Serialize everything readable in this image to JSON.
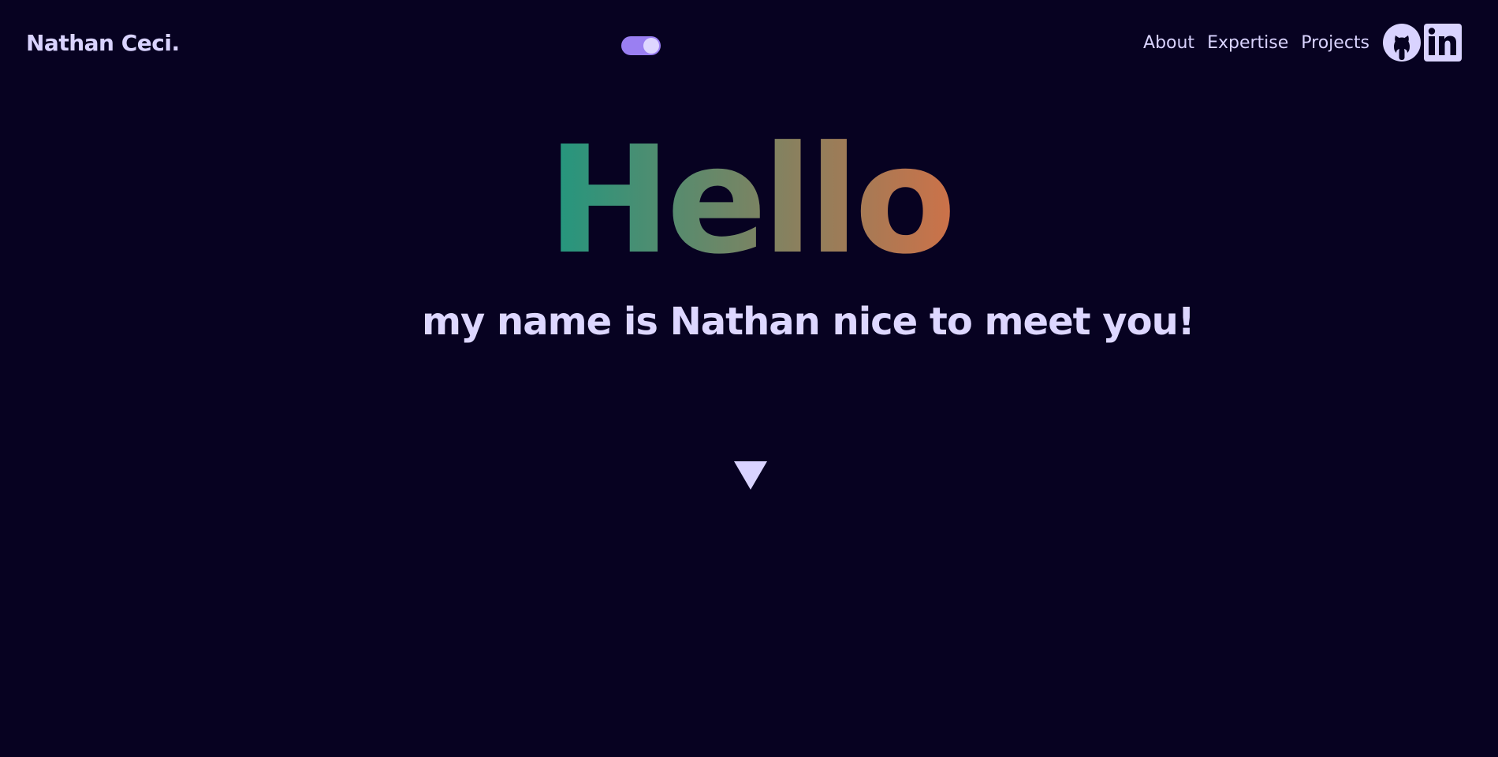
{
  "brand": {
    "name": "Nathan Ceci."
  },
  "theme_toggle": {
    "state": "on",
    "icon": "toggle-icon",
    "color": "#9a7ff2"
  },
  "nav": {
    "links": [
      {
        "label": "About"
      },
      {
        "label": "Expertise"
      },
      {
        "label": "Projects"
      }
    ],
    "social": [
      {
        "icon": "github-icon"
      },
      {
        "icon": "linkedin-icon"
      }
    ]
  },
  "hero": {
    "title": "Hello,",
    "subtitle": "my name is Nathan nice to meet you!",
    "gradient_start": "#21977f",
    "gradient_end": "#e26d42",
    "subtitle_color": "#ddd7ff"
  },
  "scroll_indicator": {
    "icon": "triangle-down-icon",
    "color": "#d9d3ff"
  },
  "colors": {
    "background": "#070221",
    "text": "#d9d3ff"
  }
}
